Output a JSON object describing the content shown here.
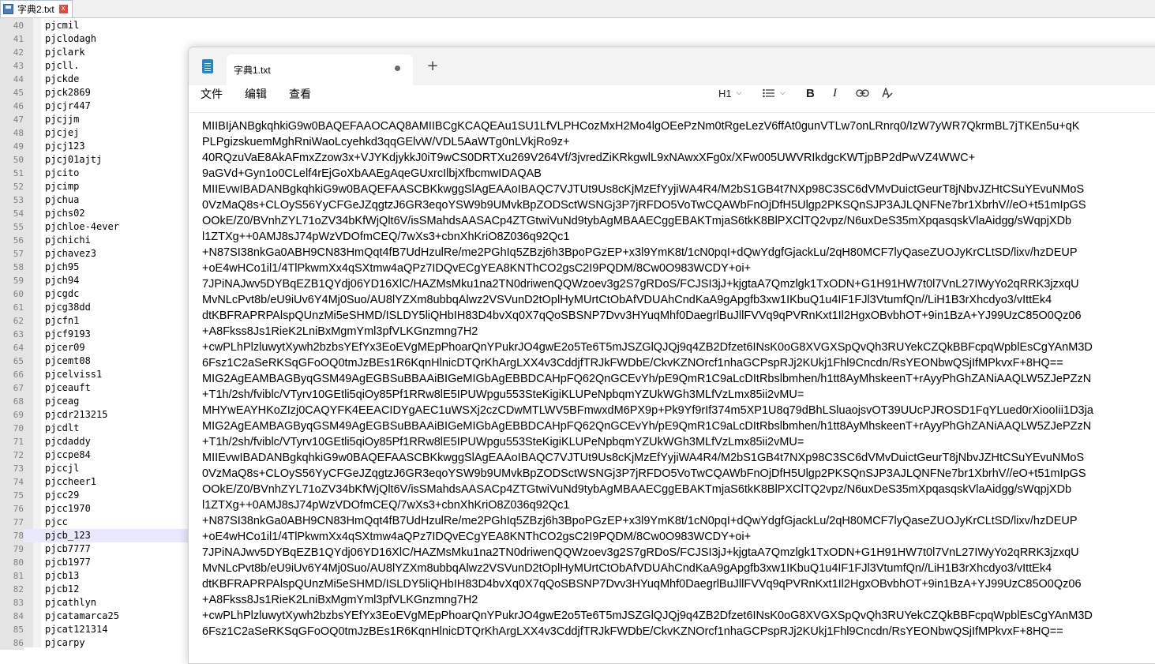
{
  "back_window": {
    "tab": {
      "title": "字典2.txt",
      "close_label": "x"
    },
    "current_line": 78,
    "lines": [
      {
        "n": "40",
        "t": "pjcmil"
      },
      {
        "n": "41",
        "t": "pjclodagh"
      },
      {
        "n": "42",
        "t": "pjclark"
      },
      {
        "n": "43",
        "t": "pjcll."
      },
      {
        "n": "44",
        "t": "pjckde"
      },
      {
        "n": "45",
        "t": "pjck2869"
      },
      {
        "n": "46",
        "t": "pjcjr447"
      },
      {
        "n": "47",
        "t": "pjcjjm"
      },
      {
        "n": "48",
        "t": "pjcjej"
      },
      {
        "n": "49",
        "t": "pjcj123"
      },
      {
        "n": "50",
        "t": "pjcj01ajtj"
      },
      {
        "n": "51",
        "t": "pjcito"
      },
      {
        "n": "52",
        "t": "pjcimp"
      },
      {
        "n": "53",
        "t": "pjchua"
      },
      {
        "n": "54",
        "t": "pjchs02"
      },
      {
        "n": "55",
        "t": "pjchloe-4ever"
      },
      {
        "n": "56",
        "t": "pjchichi"
      },
      {
        "n": "57",
        "t": "pjchavez3"
      },
      {
        "n": "58",
        "t": "pjch95"
      },
      {
        "n": "59",
        "t": "pjch94"
      },
      {
        "n": "60",
        "t": "pjcgdc"
      },
      {
        "n": "61",
        "t": "pjcg38dd"
      },
      {
        "n": "62",
        "t": "pjcfn1"
      },
      {
        "n": "63",
        "t": "pjcf9193"
      },
      {
        "n": "64",
        "t": "pjcer09"
      },
      {
        "n": "65",
        "t": "pjcemt08"
      },
      {
        "n": "66",
        "t": "pjcelviss1"
      },
      {
        "n": "67",
        "t": "pjceauft"
      },
      {
        "n": "68",
        "t": "pjceag"
      },
      {
        "n": "69",
        "t": "pjcdr213215"
      },
      {
        "n": "70",
        "t": "pjcdlt"
      },
      {
        "n": "71",
        "t": "pjcdaddy"
      },
      {
        "n": "72",
        "t": "pjccpe84"
      },
      {
        "n": "73",
        "t": "pjccjl"
      },
      {
        "n": "74",
        "t": "pjccheer1"
      },
      {
        "n": "75",
        "t": "pjcc29"
      },
      {
        "n": "76",
        "t": "pjcc1970"
      },
      {
        "n": "77",
        "t": "pjcc"
      },
      {
        "n": "78",
        "t": "pjcb_123"
      },
      {
        "n": "79",
        "t": "pjcb7777"
      },
      {
        "n": "80",
        "t": "pjcb1977"
      },
      {
        "n": "81",
        "t": "pjcb13"
      },
      {
        "n": "82",
        "t": "pjcb12"
      },
      {
        "n": "83",
        "t": "pjcathlyn"
      },
      {
        "n": "84",
        "t": "pjcatamarca25"
      },
      {
        "n": "85",
        "t": "pjcat121314"
      },
      {
        "n": "86",
        "t": "pjcarpy"
      }
    ]
  },
  "notepad": {
    "tab": {
      "title": "字典1.txt",
      "new_tab": "+"
    },
    "menu": {
      "file": "文件",
      "edit": "编辑",
      "view": "查看"
    },
    "toolbar": {
      "heading": "H1",
      "bold": "B",
      "italic": "I"
    },
    "lines": [
      "MIIBIjANBgkqhkiG9w0BAQEFAAOCAQ8AMIIBCgKCAQEAu1SU1LfVLPHCozMxH2Mo4lgOEePzNm0tRgeLezV6ffAt0gunVTLw7onLRnrq0/IzW7yWR7QkrmBL7jTKEn5u+qK",
      "PLPgizskuemMghRniWaoLcyehkd3qqGElvW/VDL5AaWTg0nLVkjRo9z+",
      "40RQzuVaE8AkAFmxZzow3x+VJYKdjykkJ0iT9wCS0DRTXu269V264Vf/3jvredZiKRkgwlL9xNAwxXFg0x/XFw005UWVRIkdgcKWTjpBP2dPwVZ4WWC+",
      "9aGVd+Gyn1o0CLelf4rEjGoXbAAEgAqeGUxrcIlbjXfbcmwIDAQAB",
      "MIIEvwIBADANBgkqhkiG9w0BAQEFAASCBKkwggSlAgEAAoIBAQC7VJTUt9Us8cKjMzEfYyjiWA4R4/M2bS1GB4t7NXp98C3SC6dVMvDuictGeurT8jNbvJZHtCSuYEvuNMoS",
      "0VzMaQ8s+CLOyS56YyCFGeJZqgtzJ6GR3eqoYSW9b9UMvkBpZODSctWSNGj3P7jRFDO5VoTwCQAWbFnOjDfH5Ulgp2PKSQnSJP3AJLQNFNe7br1XbrhV//eO+t51mIpGS",
      "OOkE/Z0/BVnhZYL71oZV34bKfWjQlt6V/isSMahdsAASACp4ZTGtwiVuNd9tybAgMBAAECggEBAKTmjaS6tkK8BlPXClTQ2vpz/N6uxDeS35mXpqasqskVlaAidgg/sWqpjXDb",
      "l1ZTXg++0AMJ8sJ74pWzVDOfmCEQ/7wXs3+cbnXhKriO8Z036q92Qc1",
      "+N87SI38nkGa0ABH9CN83HmQqt4fB7UdHzulRe/me2PGhIq5ZBzj6h3BpoPGzEP+x3l9YmK8t/1cN0pqI+dQwYdgfGjackLu/2qH80MCF7lyQaseZUOJyKrCLtSD/lixv/hzDEUP",
      "+oE4wHCo1il1/4TlPkwmXx4qSXtmw4aQPz7IDQvECgYEA8KNThCO2gsC2I9PQDM/8Cw0O983WCDY+oi+",
      "7JPiNAJwv5DYBqEZB1QYdj06YD16XlC/HAZMsMku1na2TN0driwenQQWzoev3g2S7gRDoS/FCJSI3jJ+kjgtaA7Qmzlgk1TxODN+G1H91HW7t0l7VnL27IWyYo2qRRK3jzxqU",
      "MvNLcPvt8b/eU9iUv6Y4Mj0Suo/AU8lYZXm8ubbqAlwz2VSVunD2tOplHyMUrtCtObAfVDUAhCndKaA9gApgfb3xw1IKbuQ1u4IF1FJl3VtumfQn//LiH1B3rXhcdyo3/vIttEk4",
      "dtKBFRAPRPAlspQUnzMi5eSHMD/ISLDY5liQHbIH83D4bvXq0X7qQoSBSNP7Dvv3HYuqMhf0DaegrlBuJllFVVq9qPVRnKxt1Il2HgxOBvbhOT+9in1BzA+YJ99UzC85O0Qz06",
      "+A8Fkss8Js1RieK2LniBxMgmYml3pfVLKGnzmng7H2",
      "+cwPLhPlzluwytXywh2bzbsYEfYx3EoEVgMEpPhoarQnYPukrJO4gwE2o5Te6T5mJSZGlQJQj9q4ZB2Dfzet6INsK0oG8XVGXSpQvQh3RUYekCZQkBBFcpqWpblEsCgYAnM3D",
      "6Fsz1C2aSeRKSqGFoOQ0tmJzBEs1R6KqnHlnicDTQrKhArgLXX4v3CddjfTRJkFWDbE/CkvKZNOrcf1nhaGCPspRJj2KUkj1Fhl9Cncdn/RsYEONbwQSjIfMPkvxF+8HQ==",
      "MIG2AgEAMBAGByqGSM49AgEGBSuBBAAiBIGeMIGbAgEBBDCAHpFQ62QnGCEvYh/pE9QmR1C9aLcDItRbslbmhen/h1tt8AyMhskeenT+rAyyPhGhZANiAAQLW5ZJePZzN",
      "+T1h/2sh/fviblc/VTyrv10GEtli5qiOy85Pf1RRw8lE5IPUWpgu553SteKigiKLUPeNpbqmYZUkWGh3MLfVzLmx85ii2vMU=",
      "MHYwEAYHKoZIzj0CAQYFK4EEACIDYgAEC1uWSXj2czCDwMTLWV5BFmwxdM6PX9p+Pk9Yf9rIf374m5XP1U8q79dBhLSluaojsvOT39UUcPJROSD1FqYLued0rXiooIii1D3ja",
      "MIG2AgEAMBAGByqGSM49AgEGBSuBBAAiBIGeMIGbAgEBBDCAHpFQ62QnGCEvYh/pE9QmR1C9aLcDItRbslbmhen/h1tt8AyMhskeenT+rAyyPhGhZANiAAQLW5ZJePZzN",
      "+T1h/2sh/fviblc/VTyrv10GEtli5qiOy85Pf1RRw8lE5IPUWpgu553SteKigiKLUPeNpbqmYZUkWGh3MLfVzLmx85ii2vMU=",
      "MIIEvwIBADANBgkqhkiG9w0BAQEFAASCBKkwggSlAgEAAoIBAQC7VJTUt9Us8cKjMzEfYyjiWA4R4/M2bS1GB4t7NXp98C3SC6dVMvDuictGeurT8jNbvJZHtCSuYEvuNMoS",
      "0VzMaQ8s+CLOyS56YyCFGeJZqgtzJ6GR3eqoYSW9b9UMvkBpZODSctWSNGj3P7jRFDO5VoTwCQAWbFnOjDfH5Ulgp2PKSQnSJP3AJLQNFNe7br1XbrhV//eO+t51mIpGS",
      "OOkE/Z0/BVnhZYL71oZV34bKfWjQlt6V/isSMahdsAASACp4ZTGtwiVuNd9tybAgMBAAECggEBAKTmjaS6tkK8BlPXClTQ2vpz/N6uxDeS35mXpqasqskVlaAidgg/sWqpjXDb",
      "l1ZTXg++0AMJ8sJ74pWzVDOfmCEQ/7wXs3+cbnXhKriO8Z036q92Qc1",
      "+N87SI38nkGa0ABH9CN83HmQqt4fB7UdHzulRe/me2PGhIq5ZBzj6h3BpoPGzEP+x3l9YmK8t/1cN0pqI+dQwYdgfGjackLu/2qH80MCF7lyQaseZUOJyKrCLtSD/lixv/hzDEUP",
      "+oE4wHCo1il1/4TlPkwmXx4qSXtmw4aQPz7IDQvECgYEA8KNThCO2gsC2I9PQDM/8Cw0O983WCDY+oi+",
      "7JPiNAJwv5DYBqEZB1QYdj06YD16XlC/HAZMsMku1na2TN0driwenQQWzoev3g2S7gRDoS/FCJSI3jJ+kjgtaA7Qmzlgk1TxODN+G1H91HW7t0l7VnL27IWyYo2qRRK3jzxqU",
      "MvNLcPvt8b/eU9iUv6Y4Mj0Suo/AU8lYZXm8ubbqAlwz2VSVunD2tOplHyMUrtCtObAfVDUAhCndKaA9gApgfb3xw1IKbuQ1u4IF1FJl3VtumfQn//LiH1B3rXhcdyo3/vIttEk4",
      "dtKBFRAPRPAlspQUnzMi5eSHMD/ISLDY5liQHbIH83D4bvXq0X7qQoSBSNP7Dvv3HYuqMhf0DaegrlBuJllFVVq9qPVRnKxt1Il2HgxOBvbhOT+9in1BzA+YJ99UzC85O0Qz06",
      "+A8Fkss8Js1RieK2LniBxMgmYml3pfVLKGnzmng7H2",
      "+cwPLhPlzluwytXywh2bzbsYEfYx3EoEVgMEpPhoarQnYPukrJO4gwE2o5Te6T5mJSZGlQJQj9q4ZB2Dfzet6INsK0oG8XVGXSpQvQh3RUYekCZQkBBFcpqWpblEsCgYAnM3D",
      "6Fsz1C2aSeRKSqGFoOQ0tmJzBEs1R6KqnHlnicDTQrKhArgLXX4v3CddjfTRJkFWDbE/CkvKZNOrcf1nhaGCPspRJj2KUkj1Fhl9Cncdn/RsYEONbwQSjIfMPkvxF+8HQ=="
    ]
  }
}
